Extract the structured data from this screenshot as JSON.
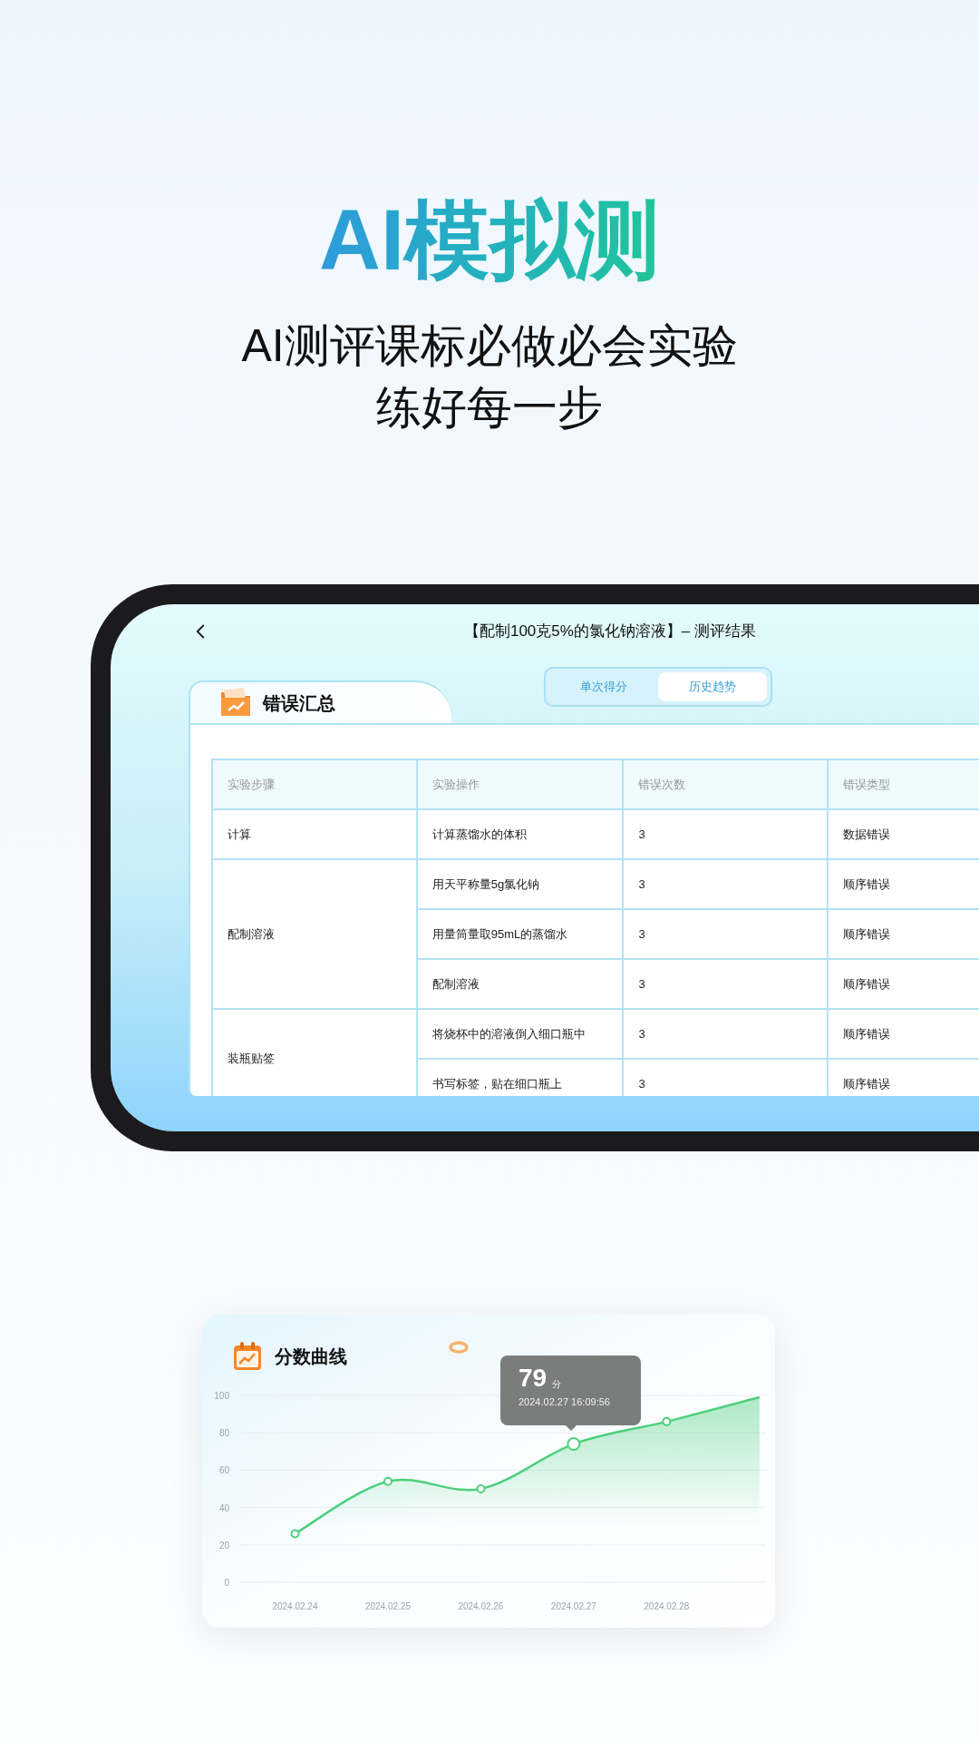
{
  "headline": "AI模拟测",
  "subtitle_lines": [
    "AI测评课标必做必会实验",
    "练好每一步"
  ],
  "tablet": {
    "title": "【配制100克5%的氯化钠溶液】– 测评结果",
    "tabs": [
      {
        "label": "单次得分",
        "selected": false
      },
      {
        "label": "历史趋势",
        "selected": true
      }
    ],
    "card_title": "错误汇总",
    "table": {
      "columns": [
        "实验步骤",
        "实验操作",
        "错误次数",
        "错误类型"
      ],
      "groups": [
        {
          "step": "计算",
          "rows": [
            {
              "operation": "计算蒸馏水的体积",
              "count": "3",
              "type": "数据错误"
            }
          ]
        },
        {
          "step": "配制溶液",
          "rows": [
            {
              "operation": "用天平称量5g氯化钠",
              "count": "3",
              "type": "顺序错误"
            },
            {
              "operation": "用量筒量取95mL的蒸馏水",
              "count": "3",
              "type": "顺序错误"
            },
            {
              "operation": "配制溶液",
              "count": "3",
              "type": "顺序错误"
            }
          ]
        },
        {
          "step": "装瓶贴签",
          "rows": [
            {
              "operation": "将烧杯中的溶液倒入细口瓶中",
              "count": "3",
              "type": "顺序错误"
            },
            {
              "operation": "书写标签，贴在细口瓶上",
              "count": "3",
              "type": "顺序错误"
            }
          ]
        }
      ]
    }
  },
  "score_card": {
    "title": "分数曲线",
    "tooltip": {
      "value": "79",
      "unit": "分",
      "time": "2024.02.27 16:09:56"
    },
    "chart_data": {
      "type": "area",
      "categories": [
        "2024.02.24",
        "2024.02.25",
        "2024.02.26",
        "2024.02.27",
        "2024.02.28",
        null
      ],
      "series": [
        {
          "color": "#4cd07d",
          "values": [
            26,
            54,
            50,
            74,
            86,
            99
          ]
        }
      ],
      "ylim": [
        0,
        100
      ],
      "grid": true,
      "yticks": [
        0,
        20,
        40,
        60,
        80,
        100
      ]
    }
  }
}
